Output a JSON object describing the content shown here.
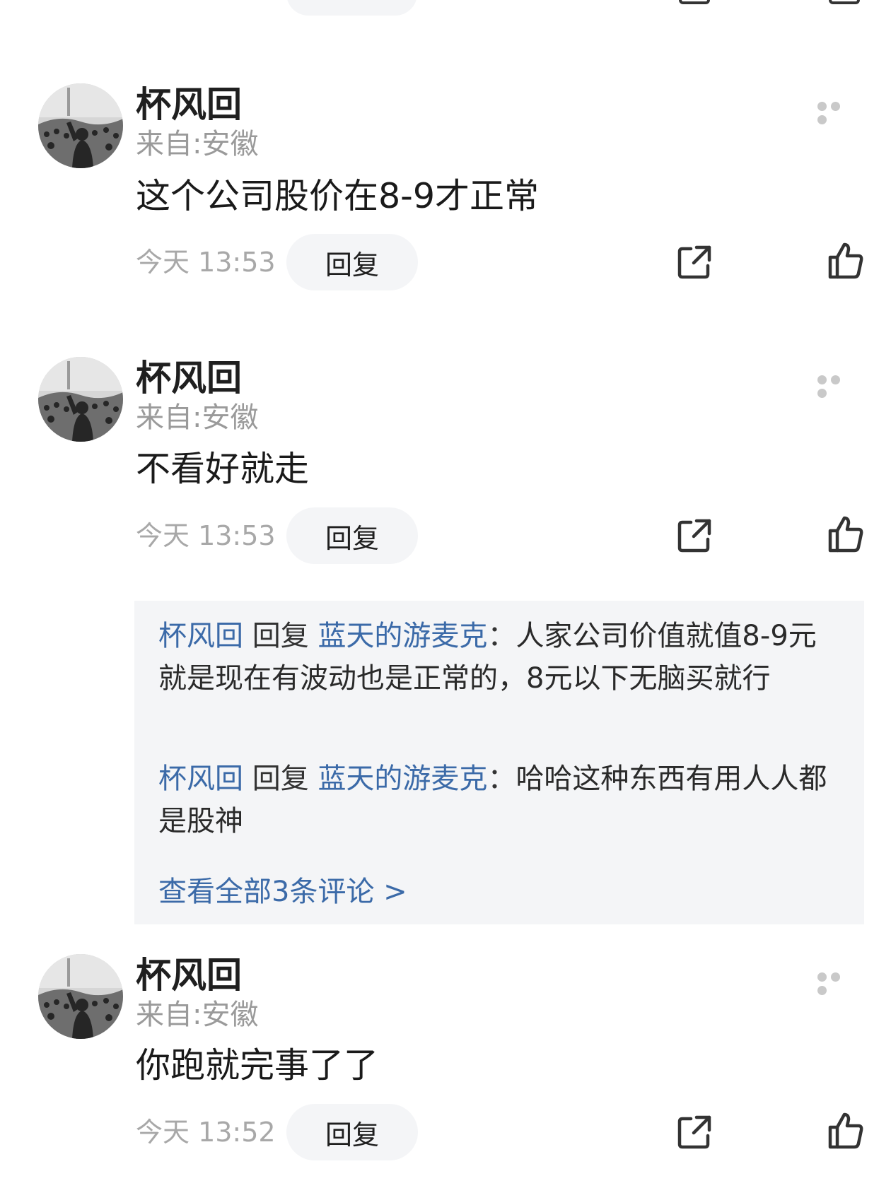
{
  "comments": [
    {
      "username": "杯风回",
      "location": "来自:安徽",
      "content": "这个公司股价在8-9才正常",
      "time": "今天 13:53",
      "reply_label": "回复"
    },
    {
      "username": "杯风回",
      "location": "来自:安徽",
      "content": "不看好就走",
      "time": "今天 13:53",
      "reply_label": "回复",
      "replies": [
        {
          "from": "杯风回",
          "verb": "回复",
          "to": "蓝天的游麦克",
          "sep": "：",
          "text": "人家公司价值就值8-9元就是现在有波动也是正常的，8元以下无脑买就行"
        },
        {
          "from": "杯风回",
          "verb": "回复",
          "to": "蓝天的游麦克",
          "sep": "：",
          "text": "哈哈这种东西有用人人都是股神"
        }
      ],
      "view_all": "查看全部3条评论 >"
    },
    {
      "username": "杯风回",
      "location": "来自:安徽",
      "content": "你跑就完事了了",
      "time": "今天 13:52",
      "reply_label": "回复"
    }
  ],
  "icons": {
    "more": "more-dots-icon",
    "share": "share-icon",
    "like": "thumbs-up-icon",
    "avatar": "avatar-crowd-photo"
  },
  "colors": {
    "link_blue": "#3b6aa8",
    "pill_bg": "#f4f5f7",
    "muted_text": "#a8a8a8"
  }
}
